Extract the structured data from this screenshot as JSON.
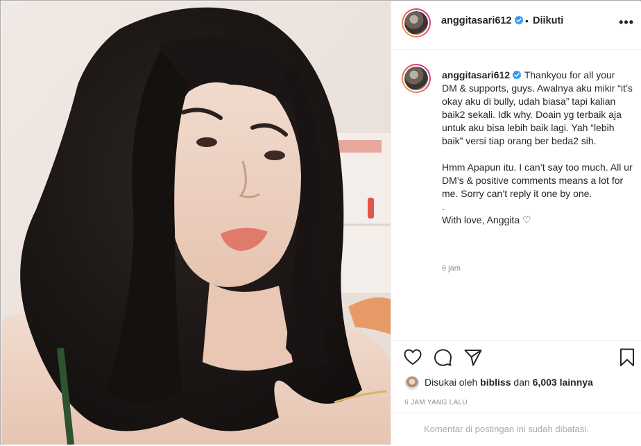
{
  "post": {
    "username": "anggitasari612",
    "follow_status": "Diikuti",
    "more_icon": "more-options-icon",
    "caption_paragraphs": [
      "Thankyou for all your DM & supports, guys. Awalnya aku mikir “it’s okay aku di bully, udah biasa” tapi kalian baik2 sekali. Idk why. Doain yg terbaik aja untuk aku bisa lebih baik lagi. Yah “lebih baik” versi tiap orang ber beda2 sih.",
      "Hmm Apapun itu. I can’t say too much. All ur DM’s & positive comments means a lot for me. Sorry can’t reply it one by one.",
      ".",
      "With love, Anggita ♡"
    ],
    "caption_time": "6 jam",
    "likes_prefix": "Disukai oleh",
    "likes_user": "bibliss",
    "likes_middle": "dan",
    "likes_count": "6,003 lainnya",
    "posted_ago": "6 JAM YANG LALU",
    "comments_disabled": "Komentar di postingan ini sudah dibatasi."
  },
  "colors": {
    "verified": "#3897f0",
    "text": "#262626",
    "muted": "#8e8e8e"
  }
}
